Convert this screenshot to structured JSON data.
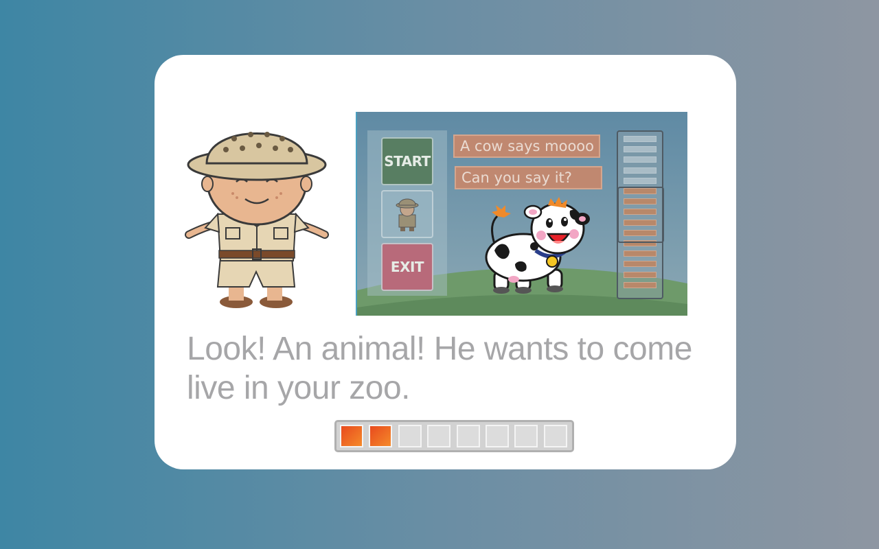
{
  "preview": {
    "start_label": "START",
    "exit_label": "EXIT",
    "bubble_1": "A cow says moooo",
    "bubble_2": "Can you say it?",
    "meter": {
      "segments_total": 15,
      "segments_filled": 10
    }
  },
  "caption": {
    "line_1": "Look! An animal! He wants to come",
    "line_2": "live in your zoo."
  },
  "progress": {
    "total": 8,
    "completed": 2
  },
  "colors": {
    "accent_orange": "#e84a1e",
    "caption_gray": "#a6a6a8"
  }
}
